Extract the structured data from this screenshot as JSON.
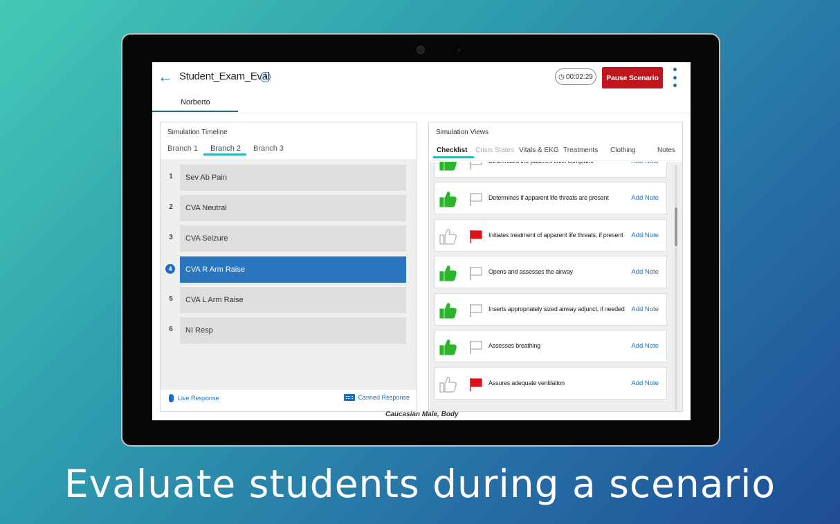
{
  "header": {
    "title": "Student_Exam_Eval",
    "timer": "00:02:29",
    "pause_label": "Pause Scenario",
    "student_tab": "Norberto"
  },
  "timeline": {
    "panel_title": "Simulation Timeline",
    "branches": [
      "Branch 1",
      "Branch 2",
      "Branch 3"
    ],
    "active_branch": "Branch 2",
    "items": [
      {
        "num": "1",
        "label": "Sev Ab Pain"
      },
      {
        "num": "2",
        "label": "CVA Neutral"
      },
      {
        "num": "3",
        "label": "CVA Seizure"
      },
      {
        "num": "4",
        "label": "CVA R Arm Raise",
        "active": true
      },
      {
        "num": "5",
        "label": "CVA L Arm Raise"
      },
      {
        "num": "6",
        "label": "NI Resp"
      }
    ],
    "live_response": "Live Response",
    "canned_response": "Canned Response"
  },
  "views": {
    "panel_title": "Simulation Views",
    "tabs": [
      "Checklist",
      "Crisis States",
      "Vitals & EKG",
      "Treatments",
      "Clothing",
      "Notes"
    ],
    "active_tab": "Checklist",
    "checklist": [
      {
        "text": "Determibes the patient's chief complaint",
        "thumb": "up",
        "flag": "off",
        "note": "Add Note"
      },
      {
        "text": "Determines if apparent life threats are present",
        "thumb": "up",
        "flag": "off",
        "note": "Add Note"
      },
      {
        "text": "Initiates treatment of apparent life threats, if present",
        "thumb": "none",
        "flag": "on",
        "note": "Add Note"
      },
      {
        "text": "Opens and assesses the airway",
        "thumb": "up",
        "flag": "off",
        "note": "Add Note"
      },
      {
        "text": "Inserts appropriately sized airway adjunct, if needed",
        "thumb": "up",
        "flag": "off",
        "note": "Add Note"
      },
      {
        "text": "Assesses breathing",
        "thumb": "up",
        "flag": "off",
        "note": "Add Note"
      },
      {
        "text": "Assures adequate ventilation",
        "thumb": "none",
        "flag": "on",
        "note": "Add Note"
      }
    ]
  },
  "body_caption": "Caucasian Male, Body",
  "tagline": "Evaluate students during a scenario",
  "colors": {
    "accent": "#1c6fc0",
    "pause_red": "#c0151c",
    "thumb_green": "#2bb52b",
    "flag_red": "#e0101a",
    "tab_underline": "#2fb4c4"
  }
}
